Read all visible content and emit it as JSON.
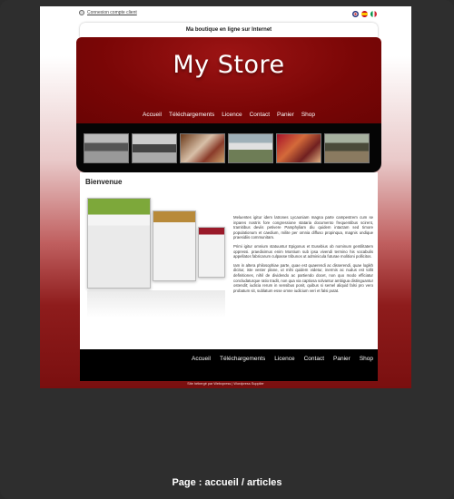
{
  "topbar": {
    "login_link": "Connexion compte client",
    "languages": [
      "English",
      "Español",
      "Italiano"
    ]
  },
  "site": {
    "tagline": "Ma boutique en ligne sur Internet",
    "logo": "My Store",
    "nav": [
      "Accueil",
      "Téléchargements",
      "Licence",
      "Contact",
      "Panier",
      "Shop"
    ]
  },
  "content": {
    "heading": "Bienvenue",
    "paragraphs": [
      "Meluentes igitur idem latrones Lycaoniam magna parte campestrem cum se inpares nostris fore congressione stataria documento frequentibus scirent, tramitibus deviis petivere Pamphyliam diu quidem intactam sed timore populationum et caedium, milite per omnia diffuso propinqua, magnis undique praesidiis communitam.",
      "Primi igitur omnium statuuntur Epigonus et Eusebius ob nominum gentilitatem oppressi. praediximus enim Montium sub ipsa vivendi termino his vocabulis appellatos fabricarum culpasse tribunos ut adminicula futurae molitioni pollicitos.",
      "Iam in altera philosophiae parte, quae est quaerendi ac disserendi, quae logikh dicitur, iste vester plane, ut mihi quidem videtur, inermis ac nudus est tollit definitiones, nihil de dividendo ac partiendo docet, non quo modo efficiatur concludaturque ratio tradit, non qua via captiosa solvantur ambigua distinguantur ostendit; iudicia rerum in sensibus ponit, quibus si semel aliquid falsi pro vero probatum sit, sublatum esse omne iudicium veri et falsi putat."
    ]
  },
  "footer": {
    "nav": [
      "Accueil",
      "Téléchargements",
      "Licence",
      "Contact",
      "Panier",
      "Shop"
    ],
    "credits": "Site hébergé par Webxpress | Wordpress Supplier"
  },
  "caption": "Page : accueil / articles"
}
